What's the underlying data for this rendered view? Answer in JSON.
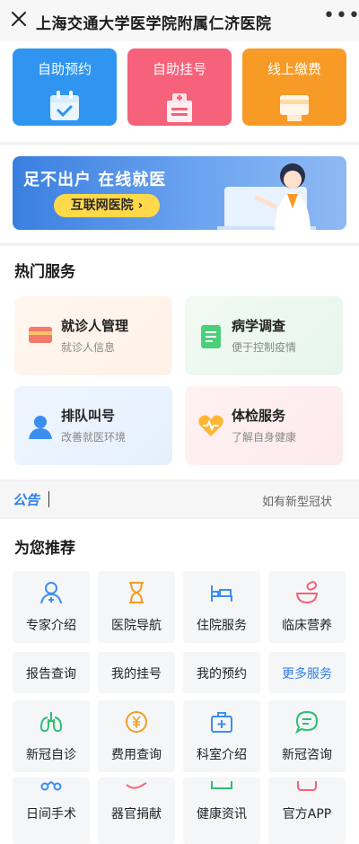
{
  "header": {
    "title": "上海交通大学医学院附属仁济医院",
    "more": "•••"
  },
  "quick_actions": [
    {
      "label": "自助预约",
      "color": "#2f95f0"
    },
    {
      "label": "自助挂号",
      "color": "#f5627a"
    },
    {
      "label": "线上缴费",
      "color": "#f79a26"
    }
  ],
  "banner": {
    "title": "足不出户 在线就医",
    "button": "互联网医院 ›"
  },
  "hot_services": {
    "title": "热门服务",
    "items": [
      {
        "title": "就诊人管理",
        "subtitle": "就诊人信息",
        "icon": "card-icon"
      },
      {
        "title": "病学调查",
        "subtitle": "便于控制疫情",
        "icon": "document-icon"
      },
      {
        "title": "排队叫号",
        "subtitle": "改善就医环境",
        "icon": "person-icon"
      },
      {
        "title": "体检服务",
        "subtitle": "了解自身健康",
        "icon": "heart-icon"
      }
    ]
  },
  "notice": {
    "label": "公告",
    "text": "如有新型冠状"
  },
  "recommend": {
    "title": "为您推荐",
    "row1": [
      "专家介绍",
      "医院导航",
      "住院服务",
      "临床营养"
    ],
    "row2": [
      "报告查询",
      "我的挂号",
      "我的预约",
      "更多服务"
    ],
    "row3": [
      "新冠自诊",
      "费用查询",
      "科室介绍",
      "新冠咨询"
    ],
    "row4": [
      "日间手术",
      "器官捐献",
      "健康资讯",
      "官方APP"
    ]
  },
  "colors": {
    "accent": "#2f7fe8",
    "more_services": "#2f7fe8"
  }
}
